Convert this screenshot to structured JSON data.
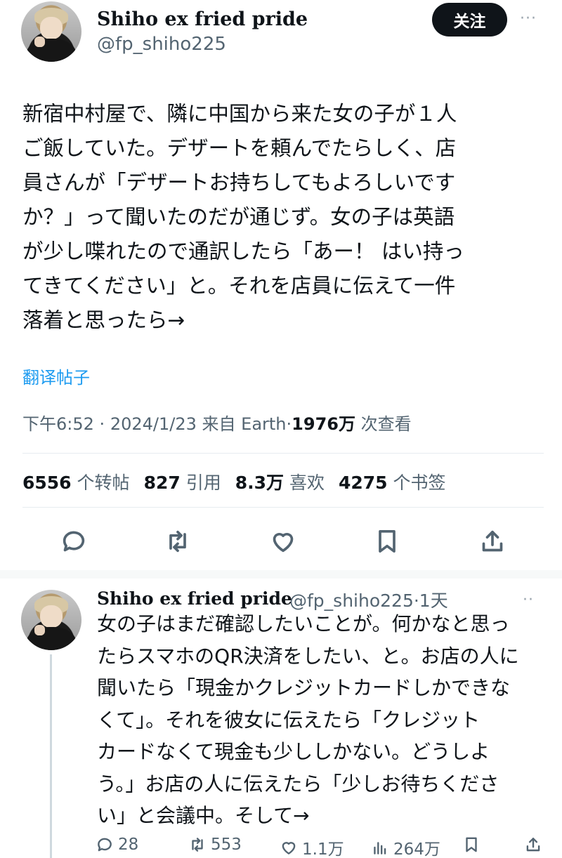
{
  "main_tweet": {
    "author": {
      "display_name": "Shiho ex fried pride",
      "handle": "@fp_shiho225"
    },
    "follow_label": "关注",
    "more_label": "···",
    "text": "新宿中村屋で、隣に中国から来た女の子が１人\nご飯していた。デザートを頼んでたらしく、店\n員さんが「デザートお持ちしてもよろしいです\nか？」って聞いたのだが通じず。女の子は英語\nが少し喋れたので通訳したら「あー！ はい持っ\nてきてください」と。それを店員に伝えて一件\n落着と思ったら→",
    "translate_label": "翻译帖子",
    "meta": {
      "time": "下午6:52",
      "date": "2024/1/23",
      "source": "来自 Earth",
      "views_value": "1976万",
      "views_label": "次查看",
      "sep": "·"
    },
    "stats": {
      "reposts_value": "6556",
      "reposts_label": "个转帖",
      "quotes_value": "827",
      "quotes_label": "引用",
      "likes_value": "8.3万",
      "likes_label": "喜欢",
      "bookmarks_value": "4275",
      "bookmarks_label": "个书签"
    },
    "actions": [
      "reply-icon",
      "repost-icon",
      "like-icon",
      "bookmark-icon",
      "share-icon"
    ]
  },
  "reply_tweet": {
    "author": {
      "display_name": "Shiho ex fried pride",
      "handle": "@fp_shiho225",
      "time": "·1天"
    },
    "more_label": "··",
    "text": "女の子はまだ確認したいことが。何かなと思っ\nたらスマホのQR決済をしたい、と。お店の人に\n聞いたら「現金かクレジットカードしかできな\nくて」。それを彼女に伝えたら「クレジット\nカードなくて現金も少ししかない。どうしよ\nう。」お店の人に伝えたら「少しお待ちくださ\nい」と会議中。そして→",
    "counts": {
      "replies": "28",
      "reposts": "553",
      "likes": "1.1万",
      "views": "264万"
    }
  },
  "colors": {
    "accent": "#1d9bf0",
    "text": "#0f1419",
    "muted": "#536471",
    "follow_bg": "#0f1419"
  }
}
